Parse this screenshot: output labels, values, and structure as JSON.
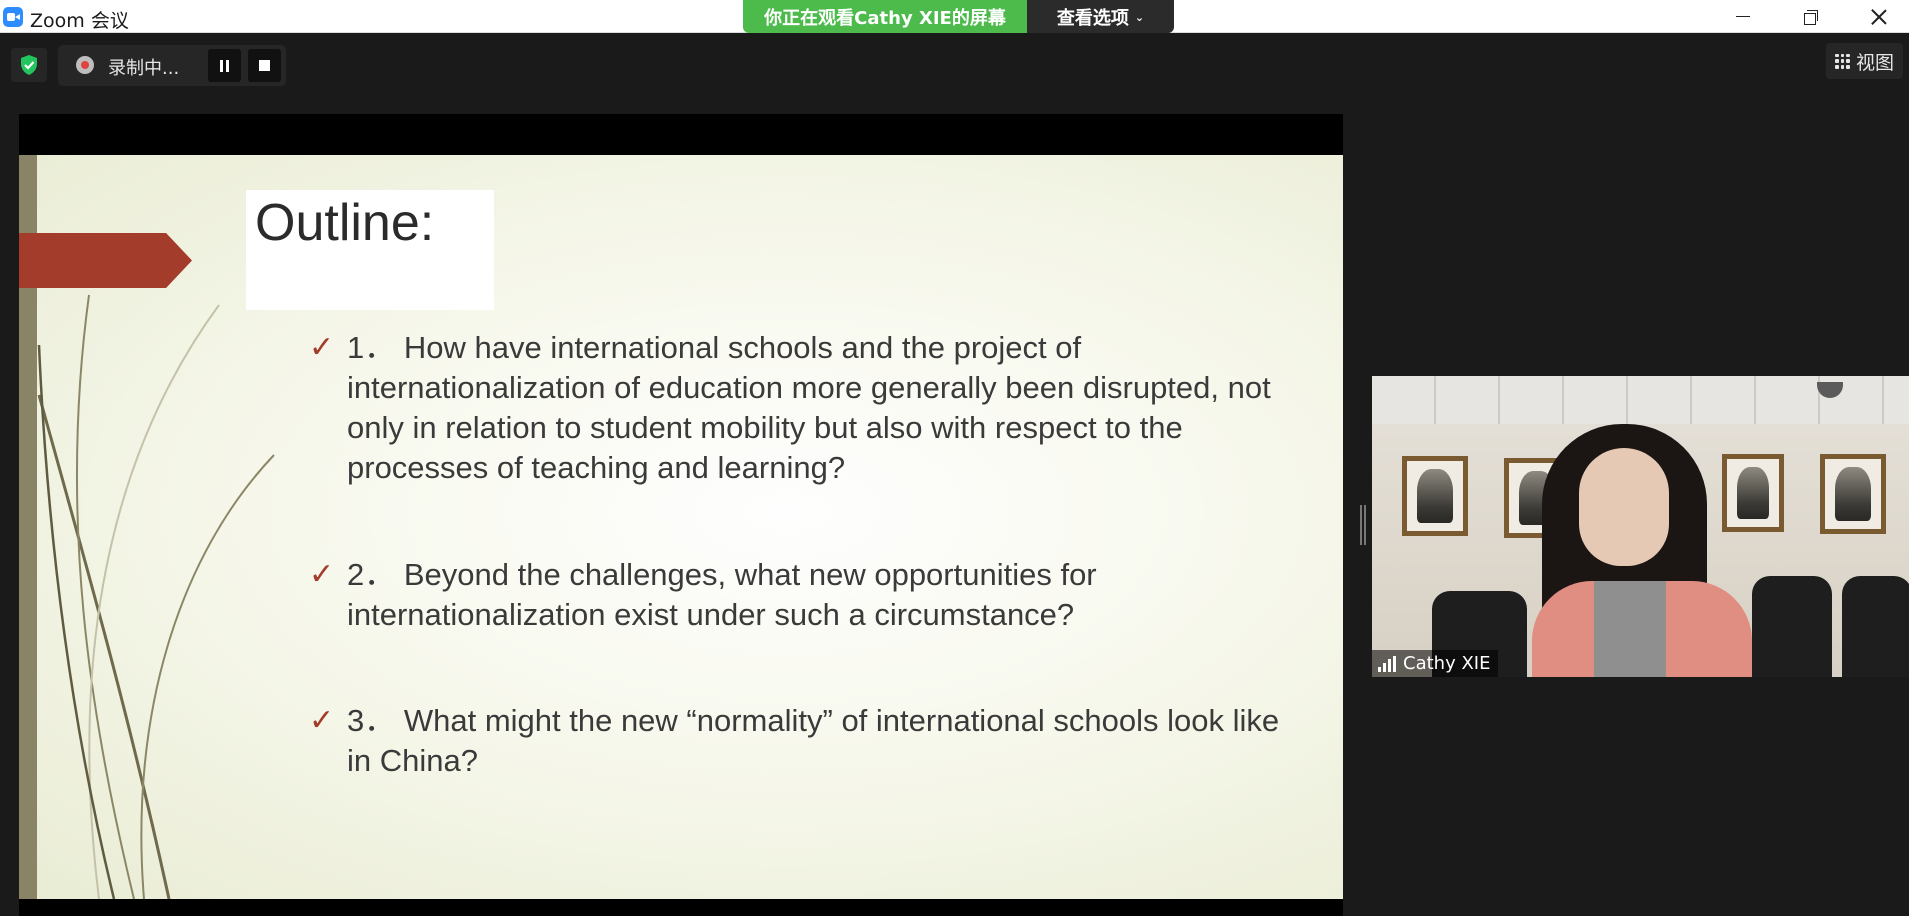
{
  "window": {
    "title": "Zoom 会议"
  },
  "share_banner": {
    "status": "你正在观看Cathy XIE的屏幕",
    "view_options": "查看选项"
  },
  "recording": {
    "label": "录制中..."
  },
  "view_button": {
    "label": "视图"
  },
  "slide": {
    "title": "Outline:",
    "bullets": [
      "1． How have international schools and the project of internationalization of education more generally been disrupted, not only in relation to student mobility but also with respect to the processes of teaching and learning?",
      "2． Beyond the challenges, what new opportunities for internationalization exist under such a circumstance?",
      "3． What might the new “normality” of international schools look like in China?"
    ],
    "check_glyph": "✓"
  },
  "participant": {
    "name": "Cathy XIE"
  },
  "colors": {
    "share_green": "#4cbb4c",
    "slide_accent": "#a33c2a",
    "zoom_blue": "#2d8cff",
    "shield_green": "#23c55e"
  },
  "icons": [
    "zoom-logo-icon",
    "minimize-icon",
    "restore-icon",
    "close-icon",
    "chevron-down-icon",
    "shield-check-icon",
    "record-icon",
    "pause-icon",
    "stop-icon",
    "grid-icon",
    "check-icon",
    "signal-icon"
  ]
}
